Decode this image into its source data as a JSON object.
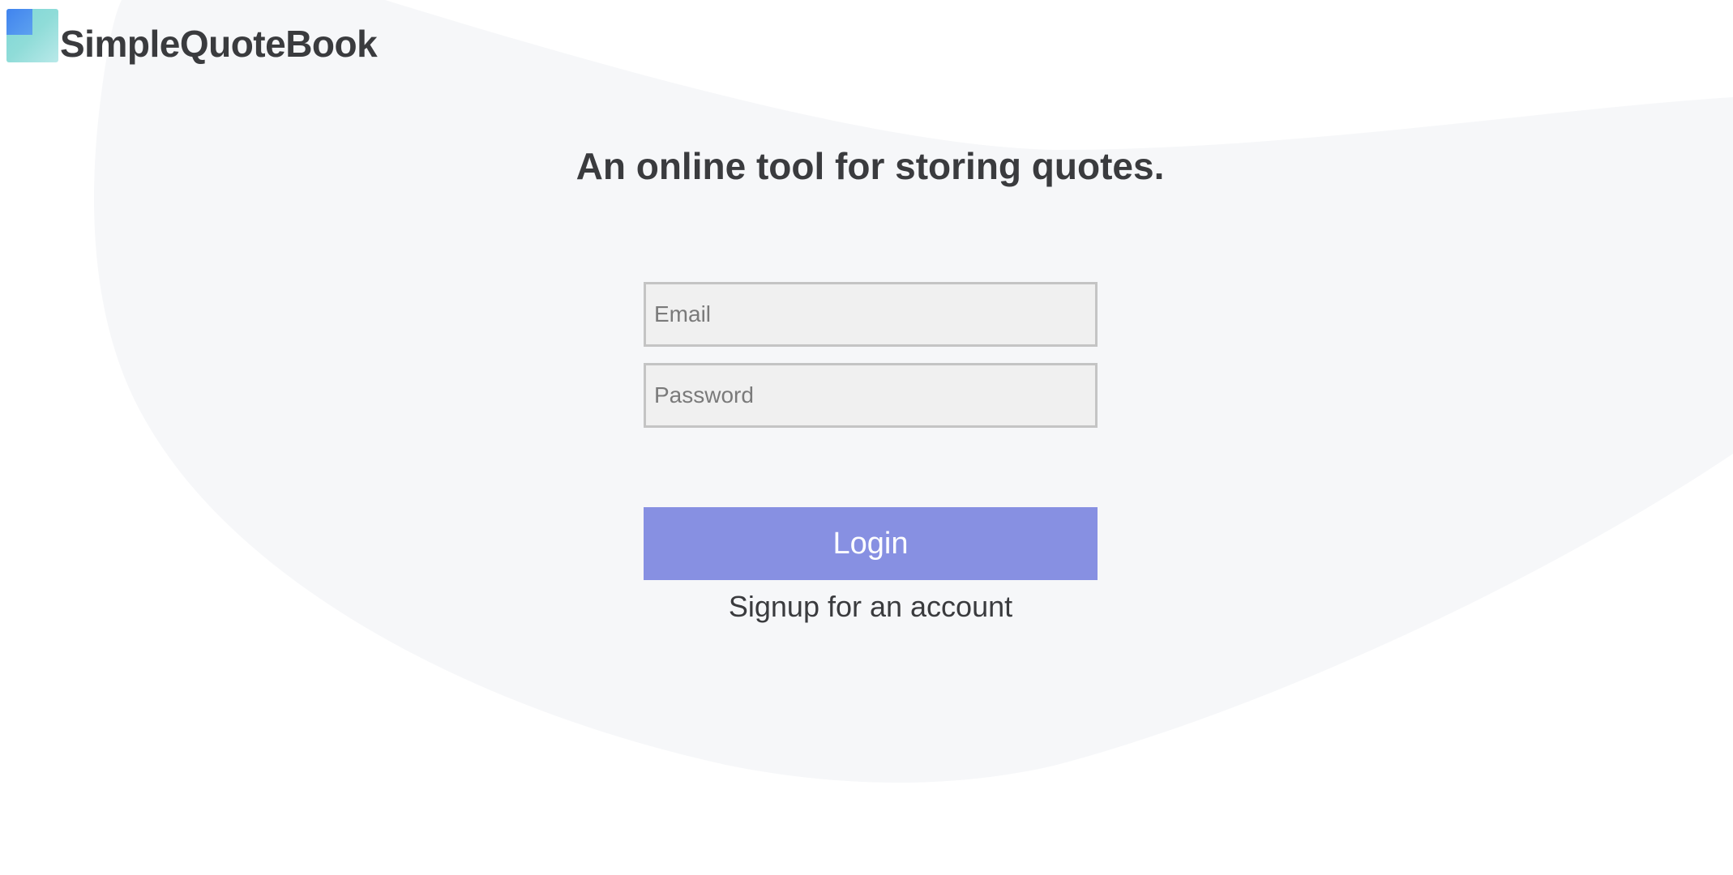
{
  "brand": {
    "name": "SimpleQuoteBook",
    "logo_icon": "stacked-squares-logo-icon"
  },
  "hero": {
    "tagline": "An online tool for storing quotes."
  },
  "login_form": {
    "email_placeholder": "Email",
    "email_value": "",
    "password_placeholder": "Password",
    "password_value": "",
    "login_label": "Login",
    "signup_label": "Signup for an account"
  },
  "colors": {
    "text": "#3a3b3e",
    "background_blob": "#f6f7f9",
    "login_button": "#8790e2",
    "input_background": "#f0f0f0",
    "input_border": "#c4c4c4",
    "logo_blue": "#3d7ff0",
    "logo_teal": "#7fd6d6"
  }
}
